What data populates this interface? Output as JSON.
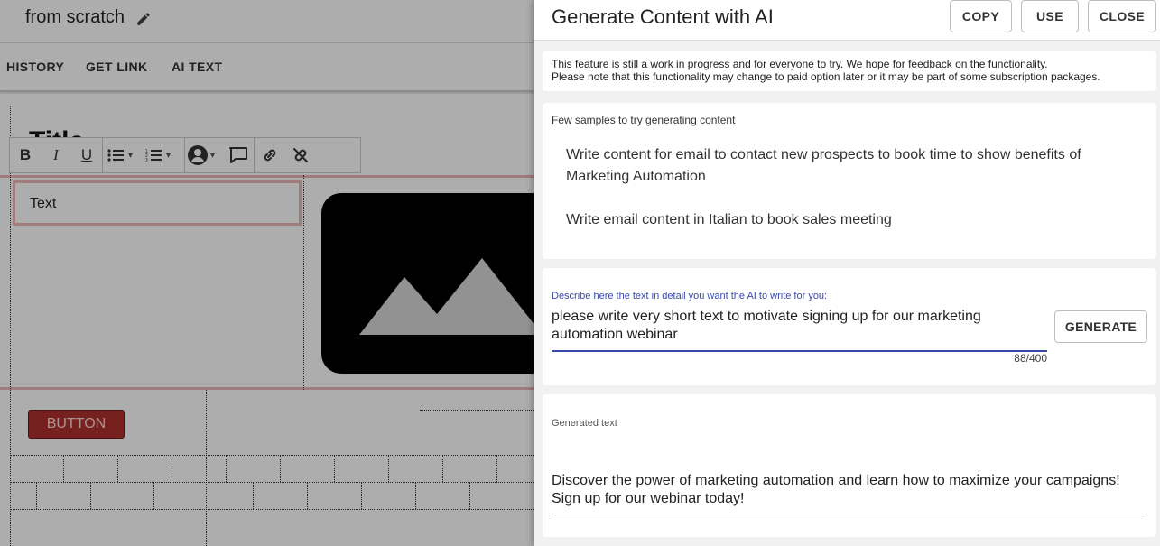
{
  "editor": {
    "doc_title": "from scratch",
    "menu": [
      "HISTORY",
      "GET LINK",
      "AI TEXT"
    ],
    "heading": "Title",
    "text_block": "Text",
    "demo_button": "BUTTON"
  },
  "panel": {
    "title": "Generate Content with AI",
    "buttons": {
      "copy": "COPY",
      "use": "USE",
      "close": "CLOSE"
    },
    "notice_line1": "This feature is still a work in progress and for everyone to try. We hope for feedback on the functionality.",
    "notice_line2": "Please note that this functionality may change to paid option later or it may be part of some subscription packages.",
    "samples_label": "Few samples to try generating content",
    "samples": [
      "Write content for email to contact new prospects to book time to show benefits of Marketing Automation",
      "Write email content in Italian to book sales meeting"
    ],
    "prompt_label": "Describe here the text in detail you want the AI to write for you:",
    "prompt_value": "please write very short text to motivate signing up for our marketing automation webinar",
    "counter": "88/400",
    "generate_label": "GENERATE",
    "output_label": "Generated text",
    "output_text": "Discover the power of marketing automation and learn how to maximize your campaigns! Sign up for our webinar today!"
  },
  "colors": {
    "accent": "#3949ab",
    "demo_button": "#b03030",
    "scrim": "rgba(0,0,0,0.32)"
  },
  "icons": [
    "edit-icon",
    "bold-icon",
    "italic-icon",
    "underline-icon",
    "bullet-list-icon",
    "numbered-list-icon",
    "person-icon",
    "comment-icon",
    "link-icon",
    "unlink-icon",
    "image-placeholder-icon"
  ]
}
